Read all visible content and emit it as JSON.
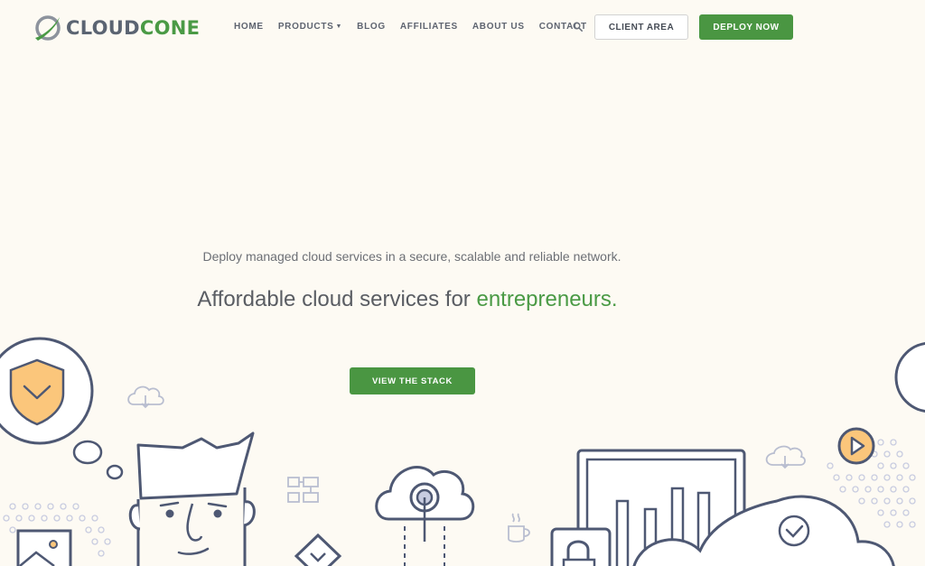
{
  "brand": {
    "name_part1": "CLOUD",
    "name_part2": "CONE",
    "logo_icon": "cloudcone-swoosh-icon",
    "green": "#4a9a45",
    "gray": "#5b6472"
  },
  "nav": {
    "items": [
      {
        "label": "HOME"
      },
      {
        "label": "PRODUCTS",
        "has_dropdown": true
      },
      {
        "label": "BLOG"
      },
      {
        "label": "AFFILIATES"
      },
      {
        "label": "ABOUT US"
      },
      {
        "label": "CONTACT"
      }
    ],
    "search_icon": "search-icon",
    "client_area_label": "CLIENT AREA",
    "deploy_label": "DEPLOY NOW"
  },
  "hero": {
    "subtitle": "Deploy managed cloud services in a secure, scalable and reliable network.",
    "headline_prefix": "Affordable cloud services for ",
    "headline_accent": "entrepreneurs.",
    "cta_label": "VIEW THE STACK"
  },
  "illustration_icons": [
    "shield-icon",
    "cloud-download-icon",
    "thought-bubble-icon",
    "person-face-icon",
    "flowchart-icon",
    "image-icon",
    "cloud-upload-icon",
    "coffee-cup-icon",
    "bar-chart-monitor-icon",
    "padlock-icon",
    "play-icon",
    "cloud-check-icon"
  ],
  "colors": {
    "background": "#fdfaf3",
    "primary_button": "#4a9642",
    "line_art": "#4e5873",
    "highlight": "#fbc67b"
  }
}
